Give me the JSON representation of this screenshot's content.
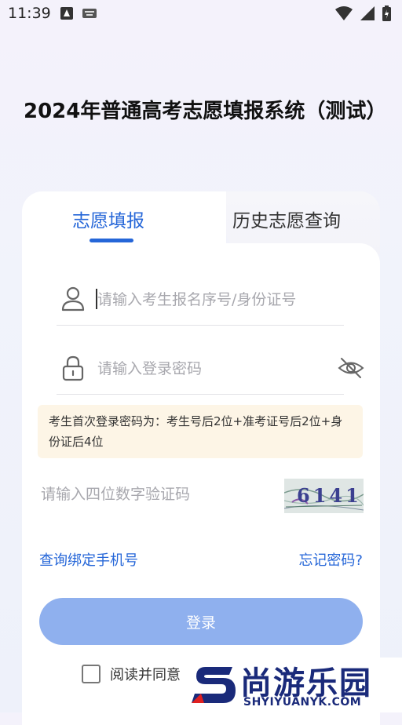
{
  "status_bar": {
    "time": "11:39"
  },
  "title": "2024年普通高考志愿填报系统（测试）",
  "tabs": [
    {
      "label": "志愿填报",
      "active": true
    },
    {
      "label": "历史志愿查询",
      "active": false
    }
  ],
  "form": {
    "username_placeholder": "请输入考生报名序号/身份证号",
    "password_placeholder": "请输入登录密码",
    "notice": "考生首次登录密码为：考生号后2位+准考证号后2位+身份证后4位",
    "captcha_placeholder": "请输入四位数字验证码",
    "captcha_value": "6141"
  },
  "links": {
    "bind_phone": "查询绑定手机号",
    "forgot_password": "忘记密码?"
  },
  "login_button": "登录",
  "agreement": "阅读并同意",
  "watermark": {
    "name": "尚游乐园",
    "site": "SHYIYUANYK.COM"
  },
  "colors": {
    "accent": "#2566d8",
    "button": "#8fb0ee",
    "notice_bg": "#fdf5e6"
  }
}
